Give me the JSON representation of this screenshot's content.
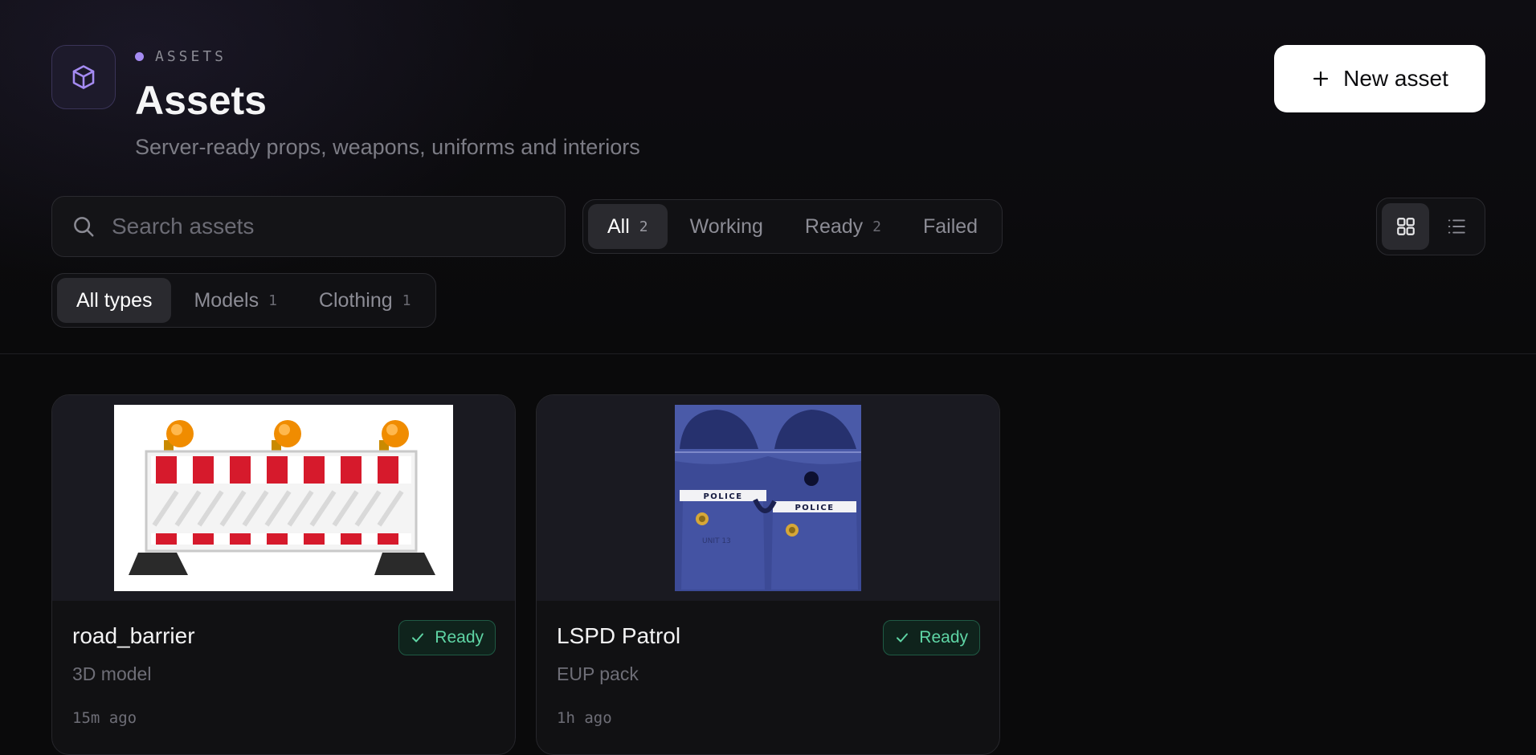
{
  "header": {
    "eyebrow": "ASSETS",
    "title": "Assets",
    "subtitle": "Server-ready props, weapons, uniforms and interiors",
    "new_button_label": "New asset",
    "icon": "cube-icon",
    "accent_color": "#a58bf2"
  },
  "search": {
    "placeholder": "Search assets",
    "value": ""
  },
  "status_filter": {
    "items": [
      {
        "label": "All",
        "count": "2",
        "active": true
      },
      {
        "label": "Working",
        "count": "",
        "active": false
      },
      {
        "label": "Ready",
        "count": "2",
        "active": false
      },
      {
        "label": "Failed",
        "count": "",
        "active": false
      }
    ]
  },
  "type_filter": {
    "items": [
      {
        "label": "All types",
        "count": "",
        "active": true
      },
      {
        "label": "Models",
        "count": "1",
        "active": false
      },
      {
        "label": "Clothing",
        "count": "1",
        "active": false
      }
    ]
  },
  "view_toggle": {
    "active": "grid",
    "options": [
      "grid-view-icon",
      "list-view-icon"
    ]
  },
  "assets": [
    {
      "name": "road_barrier",
      "type": "3D model",
      "status": "Ready",
      "time": "15m ago",
      "thumbnail": "road-barrier-image"
    },
    {
      "name": "LSPD Patrol",
      "type": "EUP pack",
      "status": "Ready",
      "time": "1h ago",
      "thumbnail": "police-uniform-texture-image"
    }
  ],
  "thumbnail_text": {
    "police_label": "POLICE",
    "unit_label": "UNIT 13"
  },
  "colors": {
    "ready_text": "#5fd5a5",
    "ready_bg": "#0f231c",
    "barrier_red": "#d61a2c",
    "uniform_blue": "#4a5aa8"
  }
}
